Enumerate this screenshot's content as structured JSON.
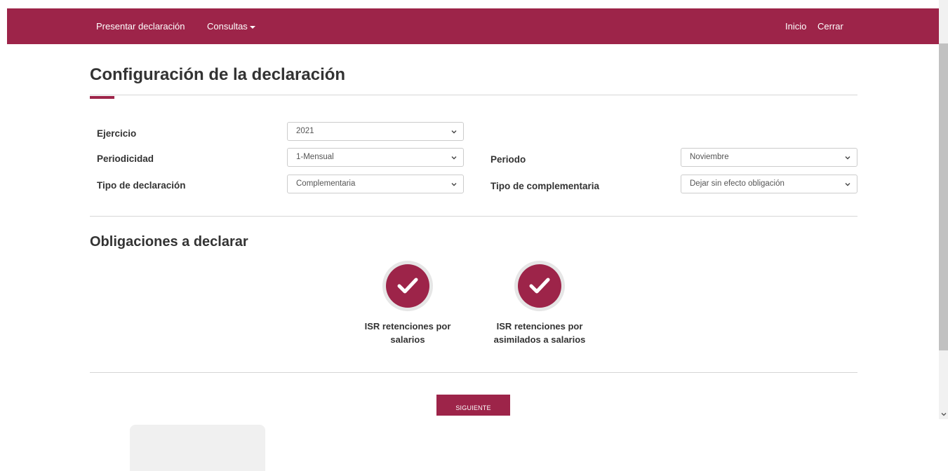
{
  "nav": {
    "left_items": [
      "Presentar declaración",
      "Consultas"
    ],
    "right_items": [
      "Inicio",
      "Cerrar"
    ]
  },
  "page": {
    "title": "Configuración de la declaración"
  },
  "form": {
    "ejercicio_label": "Ejercicio",
    "ejercicio_value": "2021",
    "periodicidad_label": "Periodicidad",
    "periodicidad_value": "1-Mensual",
    "tipo_declaracion_label": "Tipo de declaración",
    "tipo_declaracion_value": "Complementaria",
    "periodo_label": "Periodo",
    "periodo_value": "Noviembre",
    "tipo_complementaria_label": "Tipo de complementaria",
    "tipo_complementaria_value": "Dejar sin efecto obligación"
  },
  "obligations": {
    "title": "Obligaciones a declarar",
    "items": [
      {
        "line1": "ISR retenciones por",
        "line2": "salarios",
        "selected": true
      },
      {
        "line1": "ISR retenciones por",
        "line2": "asimilados a salarios",
        "selected": true
      }
    ]
  },
  "actions": {
    "next_label": "SIGUIENTE"
  },
  "colors": {
    "brand": "#9d2449",
    "text": "#333333",
    "divider": "#d6d6d6"
  },
  "icons": {
    "dropdown": "chevron-down-icon",
    "obligation_selected": "check-icon",
    "menu_caret": "caret-down-icon"
  }
}
